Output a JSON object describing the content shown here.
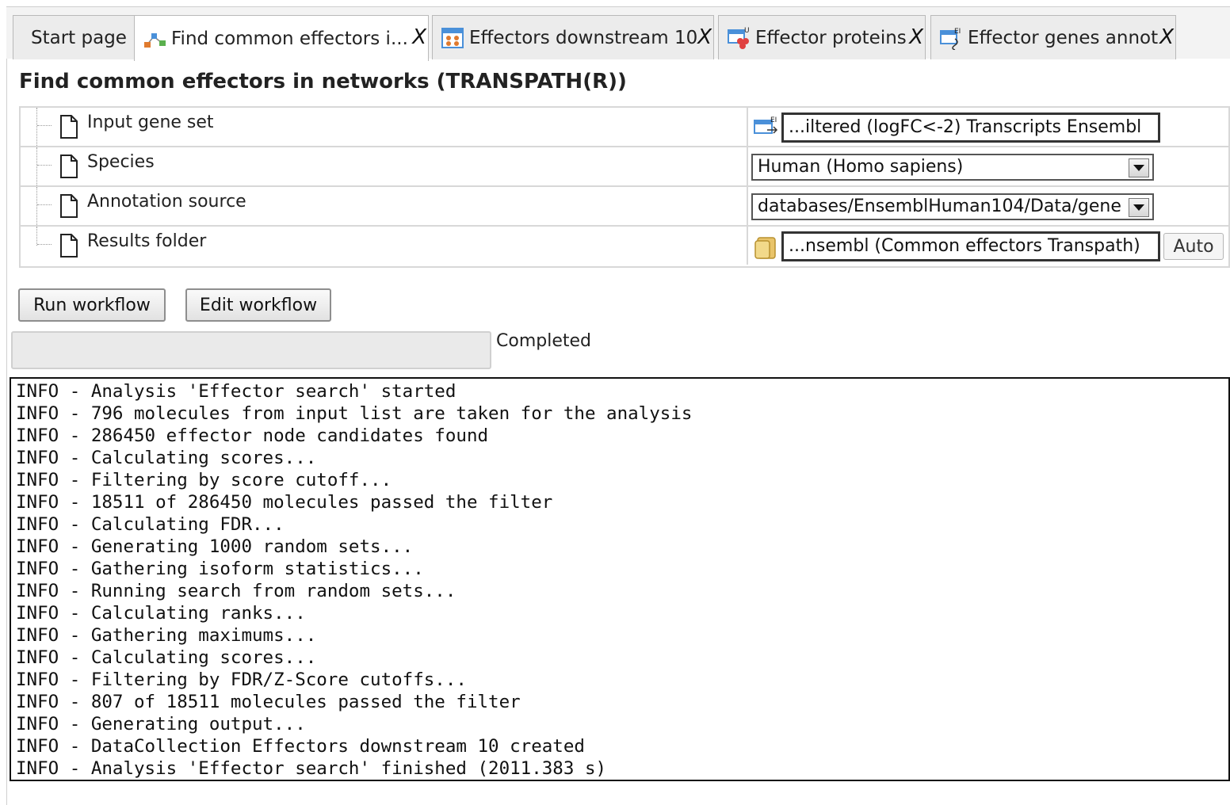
{
  "tabs": [
    {
      "label": "Start page",
      "icon": "none",
      "closable": false
    },
    {
      "label": "Find common effectors i...",
      "icon": "workflow-icon",
      "closable": true,
      "active": true
    },
    {
      "label": "Effectors downstream 10",
      "icon": "data-collection-icon",
      "closable": true
    },
    {
      "label": "Effector proteins",
      "icon": "proteins-table-icon",
      "closable": true
    },
    {
      "label": "Effector genes annot",
      "icon": "genes-table-icon",
      "closable": true
    }
  ],
  "tab_close_label": "X",
  "page_title": "Find common effectors in networks (TRANSPATH(R))",
  "parameters": [
    {
      "label": "Input gene set",
      "value": "...iltered (logFC<-2) Transcripts Ensembl",
      "control": "text-with-icon"
    },
    {
      "label": "Species",
      "value": "Human (Homo sapiens)",
      "control": "select"
    },
    {
      "label": "Annotation source",
      "value": "databases/EnsemblHuman104/Data/gene",
      "control": "select"
    },
    {
      "label": "Results folder",
      "value": "...nsembl (Common effectors Transpath)",
      "control": "text-with-folder",
      "button": "Auto"
    }
  ],
  "buttons": {
    "run": "Run workflow",
    "edit": "Edit workflow"
  },
  "progress": {
    "status": "Completed"
  },
  "log": [
    "INFO - Analysis 'Effector search' started",
    "INFO - 796 molecules from input list are taken for the analysis",
    "INFO - 286450 effector node candidates found",
    "INFO - Calculating scores...",
    "INFO - Filtering by score cutoff...",
    "INFO - 18511 of 286450 molecules passed the filter",
    "INFO - Calculating FDR...",
    "INFO - Generating 1000 random sets...",
    "INFO - Gathering isoform statistics...",
    "INFO - Running search from random sets...",
    "INFO - Calculating ranks...",
    "INFO - Gathering maximums...",
    "INFO - Calculating scores...",
    "INFO - Filtering by FDR/Z-Score cutoffs...",
    "INFO - 807 of 18511 molecules passed the filter",
    "INFO - Generating output...",
    "INFO - DataCollection Effectors downstream 10 created",
    "INFO - Analysis 'Effector search' finished (2011.383 s)"
  ]
}
